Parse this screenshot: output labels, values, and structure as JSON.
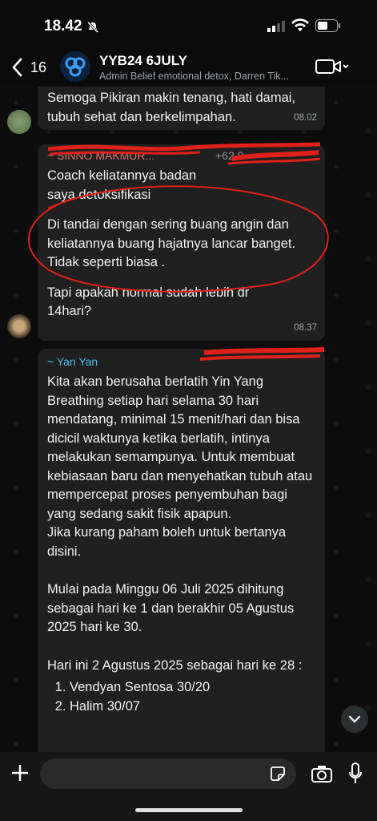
{
  "status": {
    "time": "18.42"
  },
  "header": {
    "back_count": "16",
    "title": "YYB24 6JULY",
    "subtitle": "Admin Belief emotional detox, Darren Tik..."
  },
  "messages": [
    {
      "text": "Semoga Pikiran makin tenang, hati damai, tubuh sehat dan berkelimpahan.",
      "time": "08.02"
    },
    {
      "sender": "~ SINNO MAKMUR...",
      "phone": "+62 8",
      "line1": "Coach keliatannya badan saya detoksifikasi",
      "line2": "Di tandai dengan sering buang angin dan keliatannya buang hajatnya lancar banget. Tidak seperti biasa .",
      "line3": "Tapi apakah normal sudah lebih dr 14hari?",
      "time": "08.37"
    },
    {
      "sender": "~ Yan Yan",
      "p1": "Kita akan berusaha berlatih Yin Yang Breathing setiap hari selama 30 hari mendatang, minimal 15 menit/hari dan bisa dicicil waktunya ketika berlatih, intinya melakukan semampunya. Untuk membuat kebiasaan baru  dan menyehatkan tubuh atau mempercepat proses penyembuhan bagi yang sedang sakit fisik apapun.",
      "p2": "Jika kurang paham boleh untuk bertanya disini.",
      "p3": "Mulai pada Minggu 06 Juli 2025 dihitung sebagai hari ke 1 dan berakhir 05 Agustus 2025 hari ke 30.",
      "p4": "Hari ini 2 Agustus 2025 sebagai hari ke 28 :",
      "list": [
        "Vendyan Sentosa 30/20",
        "Halim 30/07"
      ]
    }
  ],
  "colors": {
    "annotation": "#e0201a",
    "sender_blue": "#53bdeb",
    "bubble": "#202020"
  }
}
